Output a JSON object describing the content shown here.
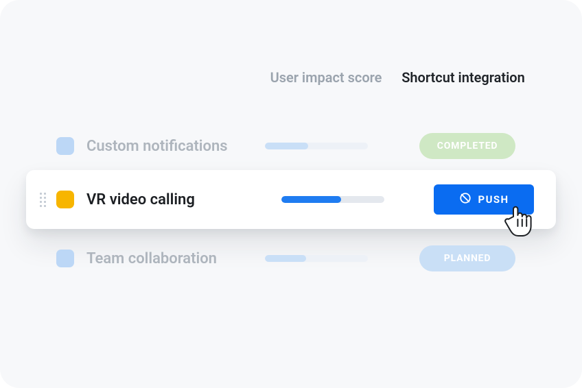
{
  "columns": {
    "score": "User impact score",
    "integration": "Shortcut integration"
  },
  "rows": [
    {
      "label": "Custom notifications",
      "score_fill": 42,
      "status_label": "COMPLETED",
      "status_kind": "completed",
      "checkbox_color": "blue-soft"
    },
    {
      "label": "VR video calling",
      "score_fill": 58,
      "action_label": "PUSH",
      "checkbox_color": "gold"
    },
    {
      "label": "Team collaboration",
      "score_fill": 40,
      "status_label": "PLANNED",
      "status_kind": "planned",
      "checkbox_color": "blue-soft"
    }
  ]
}
